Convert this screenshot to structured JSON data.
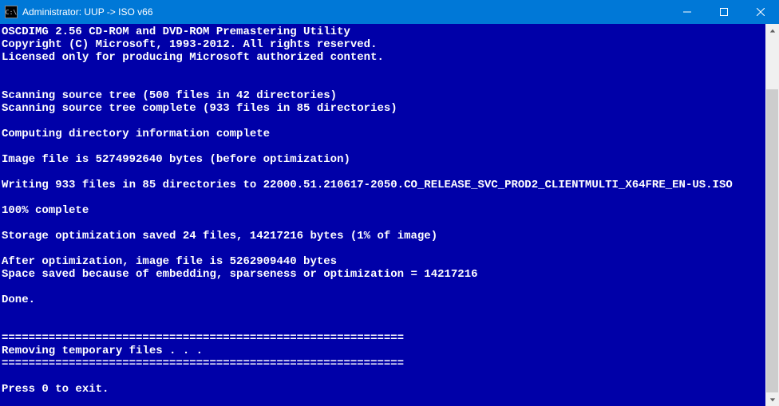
{
  "window": {
    "title": "Administrator:  UUP -> ISO v66",
    "icon_text": "C:\\"
  },
  "terminal": {
    "lines": [
      "OSCDIMG 2.56 CD-ROM and DVD-ROM Premastering Utility",
      "Copyright (C) Microsoft, 1993-2012. All rights reserved.",
      "Licensed only for producing Microsoft authorized content.",
      "",
      "",
      "Scanning source tree (500 files in 42 directories)",
      "Scanning source tree complete (933 files in 85 directories)",
      "",
      "Computing directory information complete",
      "",
      "Image file is 5274992640 bytes (before optimization)",
      "",
      "Writing 933 files in 85 directories to 22000.51.210617-2050.CO_RELEASE_SVC_PROD2_CLIENTMULTI_X64FRE_EN-US.ISO",
      "",
      "100% complete",
      "",
      "Storage optimization saved 24 files, 14217216 bytes (1% of image)",
      "",
      "After optimization, image file is 5262909440 bytes",
      "Space saved because of embedding, sparseness or optimization = 14217216",
      "",
      "Done.",
      "",
      "",
      "============================================================",
      "Removing temporary files . . .",
      "============================================================",
      "",
      "Press 0 to exit."
    ]
  }
}
